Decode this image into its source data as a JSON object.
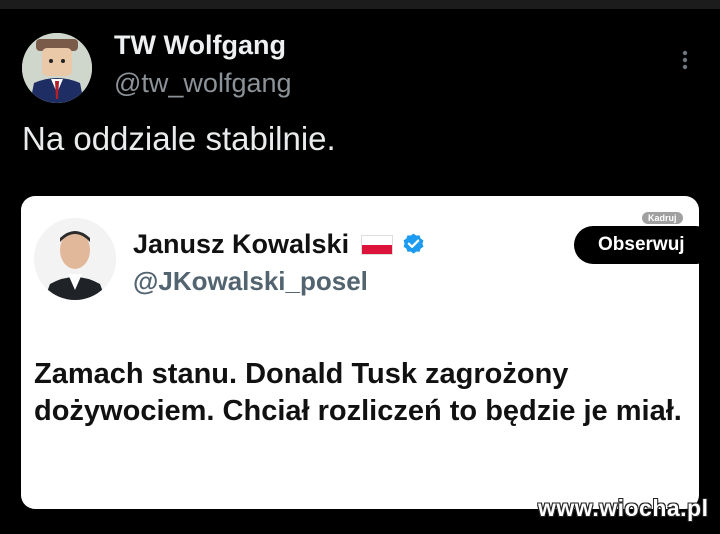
{
  "post": {
    "author_name": "TW Wolfgang",
    "author_handle": "@tw_wolfgang",
    "text": "Na oddziale stabilnie.",
    "menu_icon": "kebab-menu-icon"
  },
  "quoted": {
    "author_name": "Janusz Kowalski",
    "author_handle": "@JKowalski_posel",
    "flag_icon": "poland-flag-icon",
    "verified_icon": "verified-badge-icon",
    "crop_label": "Kadruj",
    "follow_label": "Obserwuj",
    "text": "Zamach stanu. Donald Tusk zagrożony dożywociem. Chciał rozliczeń to będzie je miał."
  },
  "watermark": "www.wiocha.pl",
  "colors": {
    "background": "#000000",
    "verified": "#1d9bf0",
    "flag_red": "#dc143c"
  }
}
